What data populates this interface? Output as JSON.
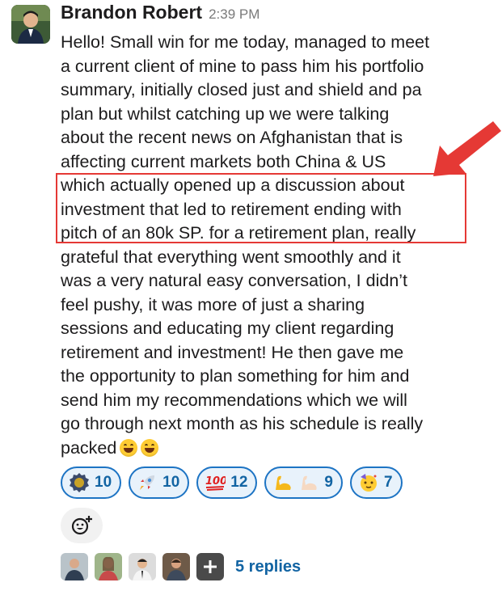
{
  "message": {
    "author": "Brandon Robert",
    "timestamp": "2:39 PM",
    "lines": [
      "Hello! Small win for me today, managed to meet",
      "a current client of mine to pass him his portfolio",
      "summary, initially closed just and shield and pa",
      "plan but whilst catching up we were talking",
      "about the recent news on Afghanistan that is",
      "affecting current markets both China & US",
      "which actually opened up a discussion about",
      "investment that led to retirement ending with",
      "pitch of an 80k SP. for a retirement plan, really",
      "grateful that everything went smoothly and it",
      "was a very natural easy conversation, I didn’t",
      "feel pushy, it was more of just a sharing",
      "sessions and educating my client regarding",
      "retirement and investment! He then gave me",
      "the opportunity to plan something for him and",
      "send him my recommendations which we will",
      "go through next month as his schedule is really",
      "packed"
    ],
    "trailing_emoji": [
      "grinning-face-with-smiling-eyes-icon",
      "grinning-face-with-smiling-eyes-icon"
    ]
  },
  "annotation": {
    "box_color": "#e53935",
    "arrow_color": "#e53935"
  },
  "reactions": [
    {
      "icon": "badge-icon",
      "count": "10"
    },
    {
      "icon": "rocket-icon",
      "count": "10"
    },
    {
      "icon": "hundred-points-icon",
      "count": "12"
    },
    {
      "icon": "flexed-biceps-icon",
      "count": "9"
    },
    {
      "icon": "partying-face-icon",
      "count": "7"
    }
  ],
  "add_reaction_icon": "add-reaction-icon",
  "thread": {
    "replies_label": "5 replies",
    "avatar_count": 5
  },
  "colors": {
    "link": "#1264a3",
    "reaction_border": "#1d74c4",
    "reaction_bg": "#e8f2fb"
  }
}
